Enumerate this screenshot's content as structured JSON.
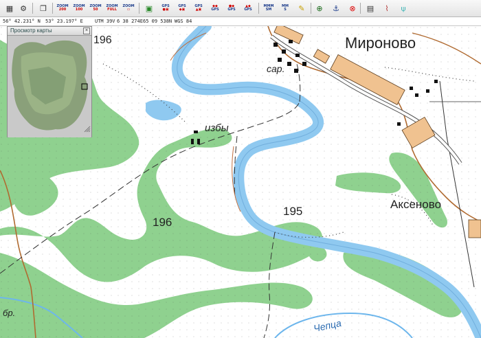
{
  "toolbar": {
    "zoom_buttons": [
      {
        "top": "ZOOM",
        "bottom": "200"
      },
      {
        "top": "ZOOM",
        "bottom": "100"
      },
      {
        "top": "ZOOM",
        "bottom": "50"
      },
      {
        "top": "ZOOM",
        "bottom": "FULL"
      },
      {
        "top": "ZOOM",
        "bottom": ""
      }
    ],
    "gps_buttons": [
      "GPS",
      "GPS",
      "GPS",
      "GPS",
      "GPS",
      "GPS"
    ],
    "mark_buttons": [
      {
        "top": "MMM",
        "bottom": "SM"
      },
      {
        "top": "MM",
        "bottom": "S"
      }
    ],
    "icons": [
      "grid-icon",
      "settings-icon",
      "layers-icon",
      "pen-icon",
      "target-icon",
      "anchor-icon",
      "stop-icon",
      "calendar-icon",
      "profile-icon",
      "antenna-icon"
    ]
  },
  "status": {
    "lat": "56° 42.231° N",
    "lon": "53° 23.197° E",
    "utm_zone": "UTM  39V",
    "easting": "6 38 274E",
    "northing": "65 09 538N",
    "datum": "WGS 84"
  },
  "overview": {
    "title": "Просмотр карты",
    "close": "×"
  },
  "map": {
    "labels": {
      "village1": "Мироново",
      "village2": "Аксеново",
      "huts": "избы",
      "shed": "сар.",
      "elev_top": "196",
      "elev_mid": "196",
      "elev_right": "195",
      "ford": "бр.",
      "river": "Чепца"
    },
    "colors": {
      "forest": "#8fd18f",
      "water": "#8fc9f0",
      "river": "#6db6ec",
      "road_brown": "#b06a30",
      "building": "#f0c290"
    }
  }
}
